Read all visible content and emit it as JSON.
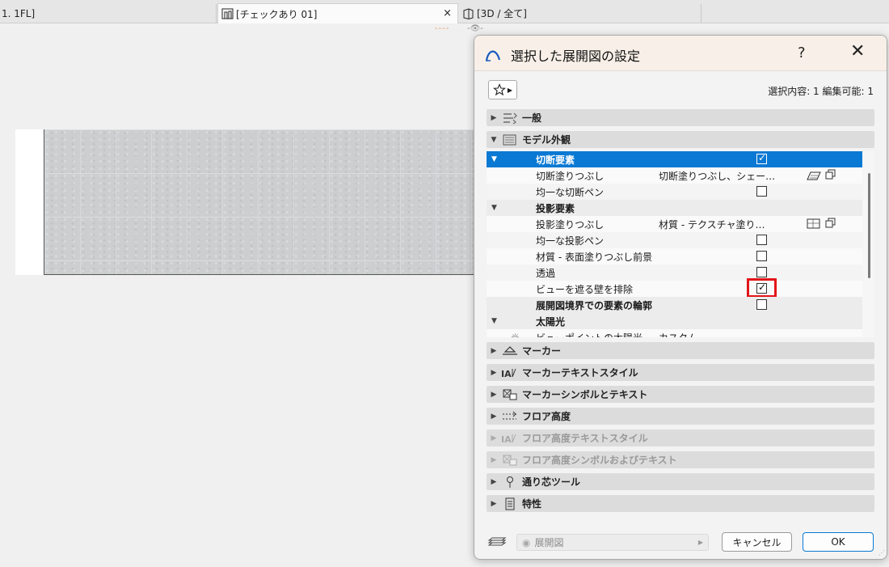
{
  "tabs": [
    {
      "label": "1. 1FL]",
      "icon": "floor-plan-icon"
    },
    {
      "label": "[チェックあり 01]",
      "icon": "elevation-view-icon",
      "close": "×"
    },
    {
      "label": "[3D / 全て]",
      "icon": "3d-view-icon"
    }
  ],
  "sub_strip": "----",
  "sub_eye": "-👁-",
  "dialog": {
    "title": "選択した展開図の設定",
    "help": "?",
    "close": "✕",
    "selection_info": "選択内容: 1 編集可能: 1",
    "sections_top": [
      {
        "label": "一般",
        "icon": "general-settings-icon",
        "expanded": false
      },
      {
        "label": "モデル外観",
        "icon": "model-appearance-icon",
        "expanded": true
      }
    ],
    "tree": [
      {
        "type": "group",
        "label": "切断要素",
        "expanded": true,
        "checked": true,
        "selected": true
      },
      {
        "type": "item",
        "label": "切断塗りつぶし",
        "value": "切断塗りつぶし、シェー…",
        "fill_icons": true
      },
      {
        "type": "item",
        "label": "均一な切断ペン",
        "checked": false
      },
      {
        "type": "group",
        "label": "投影要素",
        "expanded": true
      },
      {
        "type": "item",
        "label": "投影塗りつぶし",
        "value": "材質 - テクスチャ塗り…",
        "fill_icons": true
      },
      {
        "type": "item",
        "label": "均一な投影ペン",
        "checked": false
      },
      {
        "type": "item",
        "label": "材質 - 表面塗りつぶし前景",
        "checked": false
      },
      {
        "type": "item",
        "label": "透過",
        "checked": false
      },
      {
        "type": "item",
        "label": "ビューを遮る壁を排除",
        "checked": true,
        "highlighted": true
      },
      {
        "type": "group",
        "label": "展開図境界での要素の輪郭",
        "checked": false
      },
      {
        "type": "group",
        "label": "太陽光",
        "expanded": true
      },
      {
        "type": "item",
        "label": "ビューポイントの太陽光",
        "value": "カスタム",
        "icon": "sun-icon"
      }
    ],
    "sections_bottom": [
      {
        "label": "マーカー",
        "icon": "marker-icon",
        "disabled": false
      },
      {
        "label": "マーカーテキストスタイル",
        "icon": "marker-text-style-icon",
        "disabled": false
      },
      {
        "label": "マーカーシンボルとテキスト",
        "icon": "marker-symbol-text-icon",
        "disabled": false
      },
      {
        "label": "フロア高度",
        "icon": "floor-level-icon",
        "disabled": false
      },
      {
        "label": "フロア高度テキストスタイル",
        "icon": "floor-level-text-style-icon",
        "disabled": true
      },
      {
        "label": "フロア高度シンボルおよびテキスト",
        "icon": "floor-level-symbol-text-icon",
        "disabled": true
      },
      {
        "label": "通り芯ツール",
        "icon": "grid-tool-icon",
        "disabled": false
      },
      {
        "label": "特性",
        "icon": "properties-icon",
        "disabled": false
      }
    ],
    "footer": {
      "view_select": "展開図",
      "cancel": "キャンセル",
      "ok": "OK"
    }
  },
  "colors": {
    "selected_row": "#0a79d3",
    "highlight_box": "#e3151a",
    "title_bar": "#f8f0e8"
  }
}
